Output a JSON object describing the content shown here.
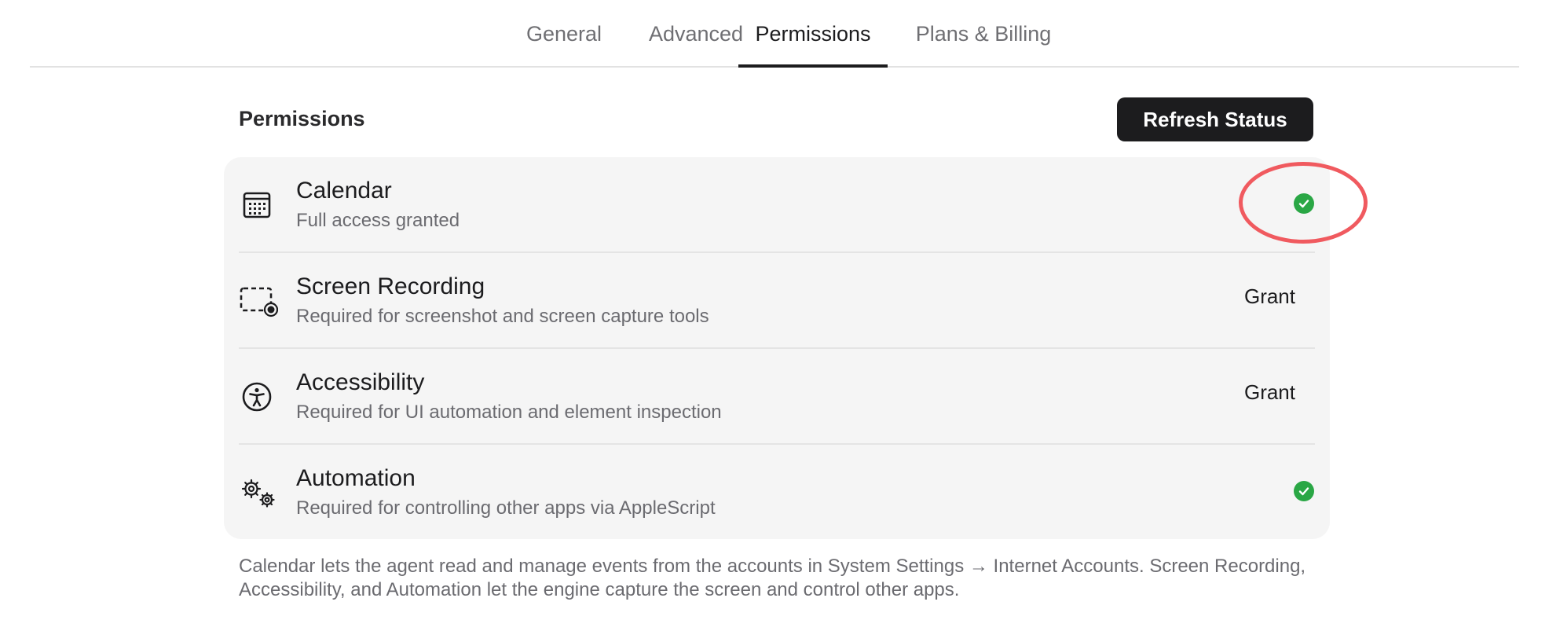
{
  "tabs": [
    {
      "label": "General",
      "active": false
    },
    {
      "label": "Advanced",
      "active": false
    },
    {
      "label": "Permissions",
      "active": true
    },
    {
      "label": "Plans & Billing",
      "active": false
    }
  ],
  "section": {
    "title": "Permissions",
    "refresh_label": "Refresh Status"
  },
  "permissions": [
    {
      "icon": "calendar-icon",
      "title": "Calendar",
      "subtitle": "Full access granted",
      "status": "granted"
    },
    {
      "icon": "screen-recording-icon",
      "title": "Screen Recording",
      "subtitle": "Required for screenshot and screen capture tools",
      "status": "not-granted",
      "action_label": "Grant"
    },
    {
      "icon": "accessibility-icon",
      "title": "Accessibility",
      "subtitle": "Required for UI automation and element inspection",
      "status": "not-granted",
      "action_label": "Grant"
    },
    {
      "icon": "gears-icon",
      "title": "Automation",
      "subtitle": "Required for controlling other apps via AppleScript",
      "status": "granted"
    }
  ],
  "footnote": "Calendar lets the agent read and manage events from the accounts in System Settings → Internet Accounts. Screen Recording, Accessibility, and Automation let the engine capture the screen and control other apps.",
  "colors": {
    "accent": "#1c1c1e",
    "success": "#2aa745",
    "highlight": "#f05a5f",
    "card_bg": "#f5f5f5"
  }
}
